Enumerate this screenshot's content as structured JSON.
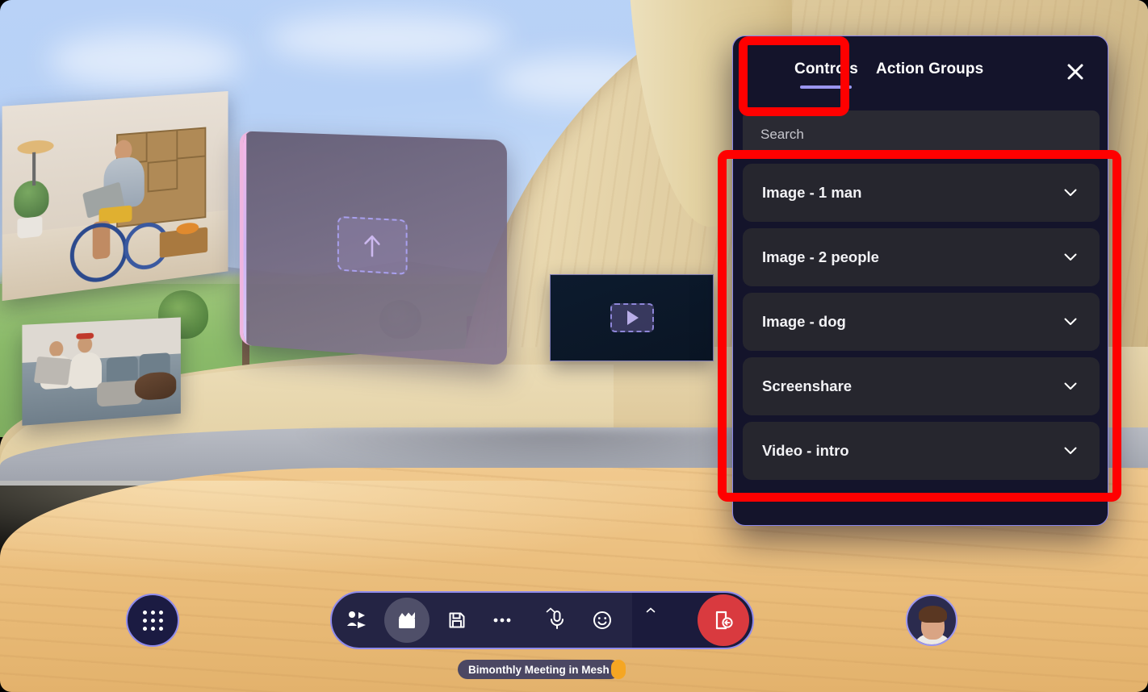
{
  "scene": {
    "name": "mesh-immersive-space",
    "photos": [
      {
        "name": "photo-man-wheelchair-laptop",
        "alt": "Man in wheelchair using a laptop in a living room"
      },
      {
        "name": "photo-two-people-couch-dog",
        "alt": "Two people laughing on a couch with a dog"
      }
    ],
    "upload_panel": {
      "icon": "upload-arrow-icon",
      "state": "empty"
    },
    "video_panel": {
      "icon": "play-icon",
      "state": "empty"
    }
  },
  "panel": {
    "tabs": [
      {
        "id": "controls",
        "label": "Controls",
        "active": true
      },
      {
        "id": "action-groups",
        "label": "Action Groups",
        "active": false
      }
    ],
    "close_icon": "close-icon",
    "search": {
      "placeholder": "Search",
      "value": ""
    },
    "items": [
      {
        "label": "Image - 1 man",
        "chevron": "chevron-down-icon"
      },
      {
        "label": "Image - 2 people",
        "chevron": "chevron-down-icon"
      },
      {
        "label": "Image - dog",
        "chevron": "chevron-down-icon"
      },
      {
        "label": "Screenshare",
        "chevron": "chevron-down-icon"
      },
      {
        "label": "Video - intro",
        "chevron": "chevron-down-icon"
      }
    ]
  },
  "annotations": {
    "color": "#ff0000",
    "boxes": [
      {
        "target": "controls-tab"
      },
      {
        "target": "controls-list"
      }
    ]
  },
  "toolbar": {
    "app_launcher": {
      "icon": "grid-apps-icon"
    },
    "buttons": [
      {
        "id": "people",
        "icon": "people-share-icon",
        "active": false,
        "caret": false
      },
      {
        "id": "scene",
        "icon": "clapperboard-icon",
        "active": true,
        "caret": false
      },
      {
        "id": "save",
        "icon": "save-floppy-icon",
        "active": false,
        "caret": false
      },
      {
        "id": "more",
        "icon": "more-dots-icon",
        "active": false,
        "caret": true
      },
      {
        "id": "microphone",
        "icon": "microphone-icon",
        "active": false,
        "caret": false
      },
      {
        "id": "reactions",
        "icon": "emoji-smiley-icon",
        "active": false,
        "caret": true
      }
    ],
    "leave": {
      "icon": "leave-door-icon",
      "color": "#d93a3f"
    }
  },
  "status": {
    "meeting_title": "Bimonthly Meeting in Mesh",
    "indicator_color": "#f5a623"
  },
  "user": {
    "avatar": "user-avatar"
  },
  "colors": {
    "panel_bg": "#14142b",
    "panel_border": "#8a86e8",
    "list_item_bg": "#26262e",
    "accent": "#9a95f0",
    "annotation": "#ff0000"
  }
}
